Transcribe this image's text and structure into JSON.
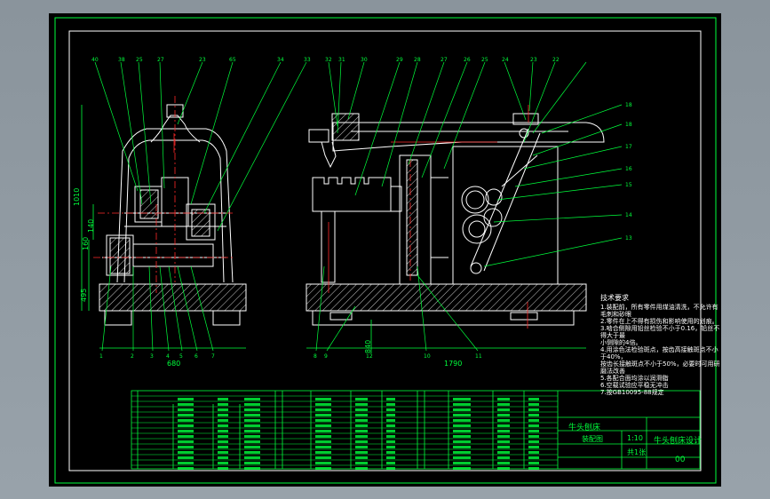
{
  "colors": {
    "background": "#8a949c",
    "sheet": "#000000",
    "frame": "#00ff3c",
    "geometry": "#ffffff",
    "dimension": "#00ff3c",
    "centerline": "#ff2a2a"
  },
  "dimensions": {
    "overall_height": "1010",
    "base_height": "495",
    "left_width": "680",
    "right_width": "1790",
    "mid_height_a": "160",
    "mid_height_b": "140",
    "h_dim": "840"
  },
  "balloons_top": [
    "40",
    "38",
    "25",
    "27",
    "23",
    "65",
    "34",
    "33",
    "32",
    "31",
    "30",
    "29",
    "28",
    "27",
    "26",
    "25",
    "24",
    "23",
    "22"
  ],
  "balloons_bottom": [
    "1",
    "2",
    "3",
    "4",
    "5",
    "6",
    "7",
    "8",
    "9",
    "10",
    "11",
    "12"
  ],
  "balloons_right": [
    "18",
    "18",
    "17",
    "16",
    "15",
    "14",
    "13"
  ],
  "notes": {
    "title": "技术要求",
    "lines": [
      "1.装配前，所有零件用煤油清洗，不允许有",
      "毛刺和砂眼",
      "2.零件在上不得有损伤和影响使用的划痕。",
      "3.啮合侧隙用铅丝检验不小于0.16，铅丝不",
      "得大于最",
      "小侧隙的4倍。",
      "4.用涂色法检验斑点，按齿高接触斑点不小",
      "于40%，",
      "按齿长接触斑点不小于50%，必要时可用研",
      "磨法改善",
      "5.各配合面均涂以润滑脂",
      "6.空载试验应平稳无冲击",
      "7.按GB10095-88规定"
    ]
  },
  "title_block": {
    "name": "牛头刨床",
    "drawing": "装配图",
    "scale": "1:10",
    "sheet": "共1张",
    "school": "牛头刨床设计",
    "number": "00"
  }
}
